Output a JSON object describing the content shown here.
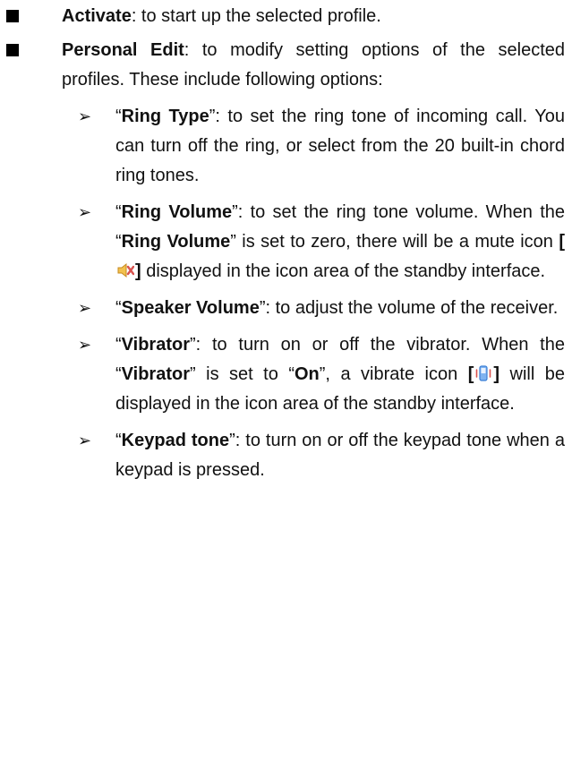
{
  "items": [
    {
      "bold": "Activate",
      "text": ": to start up the selected profile."
    },
    {
      "bold": "Personal Edit",
      "text": ": to modify setting options of the selected profiles. These include following options:"
    }
  ],
  "sub_items": {
    "ring_type": {
      "q1": "“",
      "bold": "Ring Type",
      "rest": "”: to set the ring tone of incoming call. You can turn off the ring, or select from the 20 built-in chord ring tones."
    },
    "ring_volume": {
      "q1": "“",
      "bold": "Ring Volume",
      "mid": "”: to set the ring tone volume. When the “",
      "bold2": "Ring Volume",
      "mid2": "” is set to zero, there will be a mute icon ",
      "bracket_open": "[",
      "bracket_close": "]",
      "rest": " displayed in the icon area of the standby interface."
    },
    "speaker_volume": {
      "q1": "“",
      "bold": "Speaker Volume",
      "rest": "”: to adjust the volume of the receiver."
    },
    "vibrator": {
      "q1": "“",
      "bold": "Vibrator",
      "mid": "”: to turn on or off the vibrator. When the “",
      "bold2": "Vibrator",
      "mid2": "” is set to “",
      "bold3": "On",
      "mid3": "”, a vibrate icon ",
      "bracket_open": "[",
      "bracket_close": "]",
      "rest": " will be displayed in the icon area of the standby interface."
    },
    "keypad_tone": {
      "q1": "“",
      "bold": "Keypad tone",
      "rest": "”: to turn on or off the keypad tone when a keypad is pressed."
    }
  },
  "icons": {
    "mute": "mute-speaker-icon",
    "vibrate": "vibrate-phone-icon"
  },
  "colors": {
    "text": "#111111",
    "mute_icon": "#d9534f",
    "vibrate_icon": "#3b7fd6"
  },
  "glyphs": {
    "arrow": "➢"
  }
}
